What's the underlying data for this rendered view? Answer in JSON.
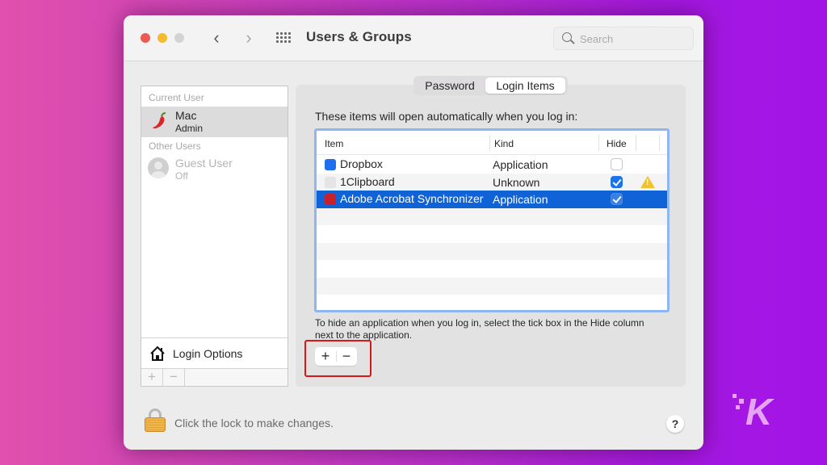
{
  "window": {
    "title": "Users & Groups",
    "search": {
      "placeholder": "Search",
      "value": ""
    }
  },
  "users": {
    "current_label": "Current User",
    "current": {
      "name": "Mac",
      "role": "Admin",
      "avatar": "chili-pepper-icon"
    },
    "other_label": "Other Users",
    "others": [
      {
        "name": "Guest User",
        "status": "Off",
        "avatar": "person-silhouette-icon"
      }
    ],
    "login_options_label": "Login Options",
    "add_label": "+",
    "remove_label": "−"
  },
  "tabs": [
    {
      "label": "Password",
      "active": false
    },
    {
      "label": "Login Items",
      "active": true
    }
  ],
  "login_items": {
    "intro": "These items will open automatically when you log in:",
    "columns": {
      "item": "Item",
      "kind": "Kind",
      "hide": "Hide"
    },
    "rows": [
      {
        "item": "Dropbox",
        "kind": "Application",
        "hide": false,
        "icon": "dropbox-icon",
        "warning": false,
        "selected": false
      },
      {
        "item": "1Clipboard",
        "kind": "Unknown",
        "hide": true,
        "icon": "generic-file-icon",
        "warning": true,
        "selected": false
      },
      {
        "item": "Adobe Acrobat Synchronizer",
        "kind": "Application",
        "hide": true,
        "icon": "adobe-acrobat-icon",
        "warning": false,
        "selected": true
      }
    ],
    "hint": "To hide an application when you log in, select the tick box in the Hide column next to the application.",
    "add_label": "+",
    "remove_label": "−"
  },
  "footer": {
    "lock_text": "Click the lock to make changes.",
    "help_label": "?"
  },
  "watermark": {
    "letter": "K"
  },
  "colors": {
    "selection": "#0f63d6",
    "table_focus_ring": "#8eb6f3",
    "highlight_box": "#d81818",
    "checkbox_on": "#1a73e8"
  }
}
